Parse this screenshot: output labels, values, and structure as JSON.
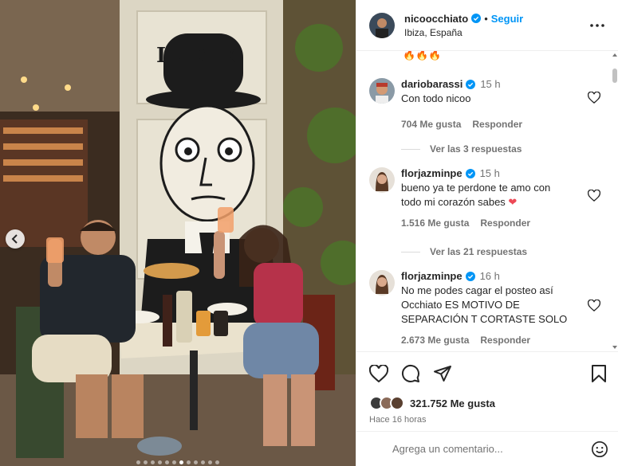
{
  "photo": {
    "sign_text": "IL DEK",
    "carousel_dots": 12,
    "active_dot": 6
  },
  "header": {
    "username": "nicoocchiato",
    "follow_label": "Seguir",
    "location": "Ibiza, España"
  },
  "comments": {
    "emoji_line": "🔥🔥🔥",
    "items": [
      {
        "username": "dariobarassi",
        "time": "15 h",
        "text": "Con todo nicoo",
        "likes": "704 Me gusta",
        "reply_label": "Responder",
        "replies": "Ver las 3 respuestas"
      },
      {
        "username": "florjazminpe",
        "time": "15 h",
        "text": "bueno ya te perdone te amo con todo mi corazón sabes",
        "likes": "1.516 Me gusta",
        "reply_label": "Responder",
        "replies": "Ver las 21 respuestas"
      },
      {
        "username": "florjazminpe",
        "time": "16 h",
        "text": "No me podes cagar el posteo así Occhiato ES MOTIVO DE SEPARACIÓN T CORTASTE SOLO",
        "likes": "2.673 Me gusta",
        "reply_label": "Responder"
      }
    ]
  },
  "footer": {
    "like_count": "321.752 Me gusta",
    "time_ago": "Hace 16 horas",
    "comment_placeholder": "Agrega un comentario..."
  },
  "icons": {
    "verified": "verified-badge-icon",
    "more": "more-options-icon",
    "like": "heart-icon",
    "comment": "comment-icon",
    "share": "share-icon",
    "save": "bookmark-icon",
    "emoji": "emoji-icon",
    "prev": "chevron-left-icon"
  },
  "colors": {
    "accent": "#0095f6",
    "verified": "#0095f6",
    "heart_red": "#ed4956",
    "muted": "#737373"
  }
}
